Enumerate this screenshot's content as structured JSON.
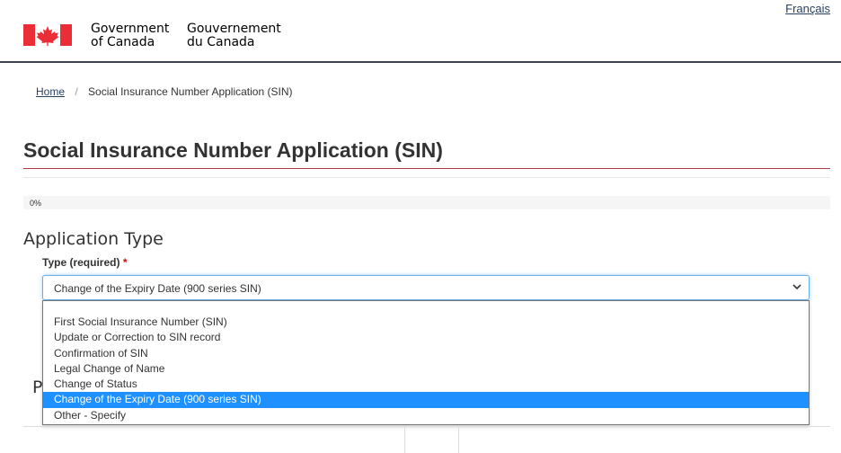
{
  "header": {
    "lang_toggle": "Français",
    "wordmark_en_line1": "Government",
    "wordmark_en_line2": "of Canada",
    "wordmark_fr_line1": "Gouvernement",
    "wordmark_fr_line2": "du Canada",
    "flag_color": "#eb2d37"
  },
  "breadcrumb": {
    "home": "Home",
    "separator": "/",
    "current": "Social Insurance Number Application (SIN)"
  },
  "page": {
    "title": "Social Insurance Number Application (SIN)"
  },
  "progress": {
    "percent": 0,
    "label": "0%"
  },
  "form": {
    "section_title": "Application Type",
    "type_label": "Type (required)",
    "required_mark": "*",
    "selected_value": "Change of the Expiry Date (900 series SIN)",
    "options": [
      "First Social Insurance Number (SIN)",
      "Update or Correction to SIN record",
      "Confirmation of SIN",
      "Legal Change of Name",
      "Change of Status",
      "Change of the Expiry Date (900 series SIN)",
      "Other - Specify"
    ],
    "selected_index": 5,
    "obscured_heading": "P"
  },
  "colors": {
    "link": "#284162",
    "title_underline": "#af3c43",
    "focus": "#66afe9",
    "option_highlight": "#1e90ff",
    "required": "#d3080c"
  }
}
